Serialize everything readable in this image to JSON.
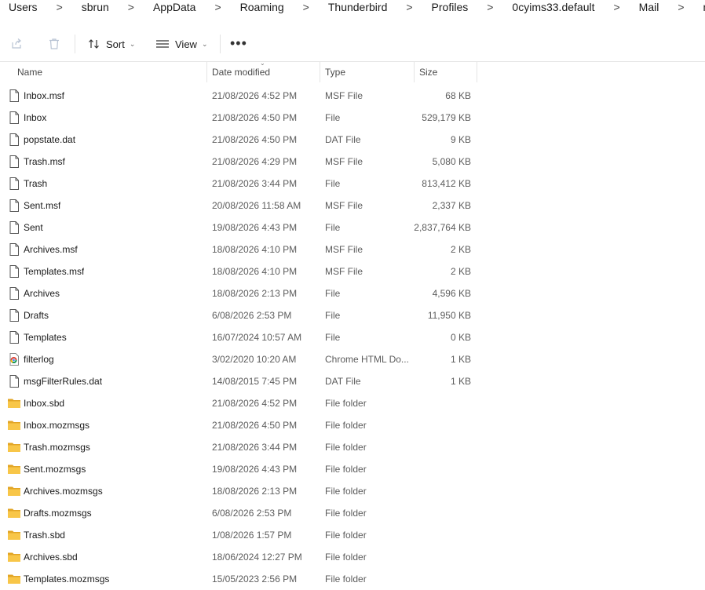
{
  "breadcrumb": [
    "Users",
    "sbrun",
    "AppData",
    "Roaming",
    "Thunderbird",
    "Profiles",
    "0cyims33.default",
    "Mail",
    "mail.bigpond.com"
  ],
  "breadcrumb_separator": ">",
  "toolbar": {
    "sort_label": "Sort",
    "view_label": "View",
    "more_label": "•••"
  },
  "columns": {
    "name": "Name",
    "date": "Date modified",
    "type": "Type",
    "size": "Size"
  },
  "files": [
    {
      "icon": "file-icon",
      "name": "Inbox.msf",
      "date": "21/08/2026 4:52 PM",
      "type": "MSF File",
      "size": "68 KB"
    },
    {
      "icon": "file-icon",
      "name": "Inbox",
      "date": "21/08/2026 4:50 PM",
      "type": "File",
      "size": "529,179 KB"
    },
    {
      "icon": "file-icon",
      "name": "popstate.dat",
      "date": "21/08/2026 4:50 PM",
      "type": "DAT File",
      "size": "9 KB"
    },
    {
      "icon": "file-icon",
      "name": "Trash.msf",
      "date": "21/08/2026 4:29 PM",
      "type": "MSF File",
      "size": "5,080 KB"
    },
    {
      "icon": "file-icon",
      "name": "Trash",
      "date": "21/08/2026 3:44 PM",
      "type": "File",
      "size": "813,412 KB"
    },
    {
      "icon": "file-icon",
      "name": "Sent.msf",
      "date": "20/08/2026 11:58 AM",
      "type": "MSF File",
      "size": "2,337 KB"
    },
    {
      "icon": "file-icon",
      "name": "Sent",
      "date": "19/08/2026 4:43 PM",
      "type": "File",
      "size": "2,837,764 KB"
    },
    {
      "icon": "file-icon",
      "name": "Archives.msf",
      "date": "18/08/2026 4:10 PM",
      "type": "MSF File",
      "size": "2 KB"
    },
    {
      "icon": "file-icon",
      "name": "Templates.msf",
      "date": "18/08/2026 4:10 PM",
      "type": "MSF File",
      "size": "2 KB"
    },
    {
      "icon": "file-icon",
      "name": "Archives",
      "date": "18/08/2026 2:13 PM",
      "type": "File",
      "size": "4,596 KB"
    },
    {
      "icon": "file-icon",
      "name": "Drafts",
      "date": "6/08/2026 2:53 PM",
      "type": "File",
      "size": "11,950 KB"
    },
    {
      "icon": "file-icon",
      "name": "Templates",
      "date": "16/07/2024 10:57 AM",
      "type": "File",
      "size": "0 KB"
    },
    {
      "icon": "chrome-icon",
      "name": "filterlog",
      "date": "3/02/2020 10:20 AM",
      "type": "Chrome HTML Do...",
      "size": "1 KB"
    },
    {
      "icon": "file-icon",
      "name": "msgFilterRules.dat",
      "date": "14/08/2015 7:45 PM",
      "type": "DAT File",
      "size": "1 KB"
    },
    {
      "icon": "folder-icon",
      "name": "Inbox.sbd",
      "date": "21/08/2026 4:52 PM",
      "type": "File folder",
      "size": ""
    },
    {
      "icon": "folder-icon",
      "name": "Inbox.mozmsgs",
      "date": "21/08/2026 4:50 PM",
      "type": "File folder",
      "size": ""
    },
    {
      "icon": "folder-icon",
      "name": "Trash.mozmsgs",
      "date": "21/08/2026 3:44 PM",
      "type": "File folder",
      "size": ""
    },
    {
      "icon": "folder-icon",
      "name": "Sent.mozmsgs",
      "date": "19/08/2026 4:43 PM",
      "type": "File folder",
      "size": ""
    },
    {
      "icon": "folder-icon",
      "name": "Archives.mozmsgs",
      "date": "18/08/2026 2:13 PM",
      "type": "File folder",
      "size": ""
    },
    {
      "icon": "folder-icon",
      "name": "Drafts.mozmsgs",
      "date": "6/08/2026 2:53 PM",
      "type": "File folder",
      "size": ""
    },
    {
      "icon": "folder-icon",
      "name": "Trash.sbd",
      "date": "1/08/2026 1:57 PM",
      "type": "File folder",
      "size": ""
    },
    {
      "icon": "folder-icon",
      "name": "Archives.sbd",
      "date": "18/06/2024 12:27 PM",
      "type": "File folder",
      "size": ""
    },
    {
      "icon": "folder-icon",
      "name": "Templates.mozmsgs",
      "date": "15/05/2023 2:56 PM",
      "type": "File folder",
      "size": ""
    }
  ],
  "colors": {
    "folder_yellow": "#f8c648",
    "folder_dark": "#e2a526",
    "header_text": "#4a4a4a",
    "secondary_text": "#5c5c5c"
  }
}
